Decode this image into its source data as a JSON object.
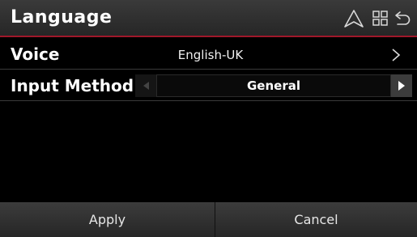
{
  "header": {
    "title": "Language",
    "icons": [
      "navigation-icon",
      "grid-menu-icon",
      "back-icon"
    ]
  },
  "settings": {
    "voice": {
      "label": "Voice",
      "value": "English-UK"
    },
    "input_method": {
      "label": "Input Method",
      "value": "General"
    }
  },
  "footer": {
    "apply_label": "Apply",
    "cancel_label": "Cancel"
  },
  "colors": {
    "accent": "#a0182a",
    "background": "#000000",
    "bar": "#2e2e2e",
    "text": "#f2f2f2"
  }
}
